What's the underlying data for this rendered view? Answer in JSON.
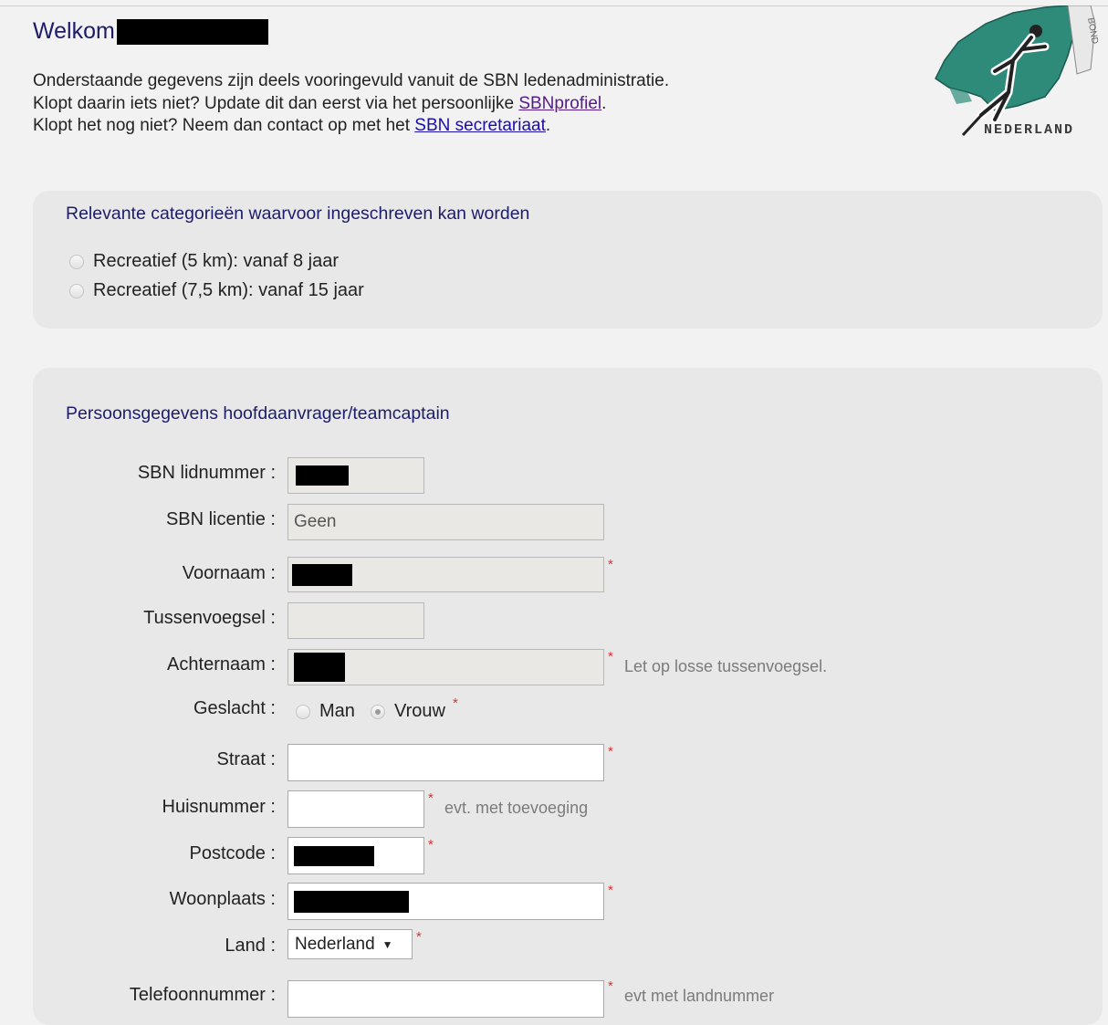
{
  "header": {
    "welcome": "Welkom",
    "intro_line1": "Onderstaande gegevens zijn deels vooringevuld vanuit de SBN ledenadministratie.",
    "intro_line2_pre": "Klopt daarin iets niet? Update dit dan eerst via het persoonlijke ",
    "intro_line2_link": "SBNprofiel",
    "intro_line2_post": ".",
    "intro_line3_pre": "Klopt het nog niet? Neem dan contact op met het ",
    "intro_line3_link": "SBN secretariaat",
    "intro_line3_post": "."
  },
  "logo": {
    "text": "NEDERLAND",
    "side_text": "BOND",
    "icon": "skater-map-logo"
  },
  "categories": {
    "title": "Relevante categorieën waarvoor ingeschreven kan worden",
    "options": [
      {
        "label": "Recreatief (5 km): vanaf 8 jaar",
        "checked": false
      },
      {
        "label": "Recreatief (7,5 km): vanaf 15 jaar",
        "checked": false
      }
    ]
  },
  "person": {
    "title": "Persoonsgegevens hoofdaanvrager/teamcaptain",
    "lidnummer_label": "SBN lidnummer :",
    "licentie_label": "SBN licentie :",
    "licentie_value": "Geen",
    "voornaam_label": "Voornaam :",
    "tussenvoegsel_label": "Tussenvoegsel :",
    "achternaam_label": "Achternaam :",
    "achternaam_hint": "Let op losse tussenvoegsel.",
    "geslacht_label": "Geslacht :",
    "gender_man": "Man",
    "gender_vrouw": "Vrouw",
    "gender_selected": "Vrouw",
    "straat_label": "Straat :",
    "huisnummer_label": "Huisnummer :",
    "huisnummer_hint": "evt. met toevoeging",
    "postcode_label": "Postcode :",
    "woonplaats_label": "Woonplaats :",
    "land_label": "Land :",
    "land_value": "Nederland",
    "telefoon_label": "Telefoonnummer :",
    "telefoon_hint": "evt met landnummer",
    "required_mark": "*"
  },
  "colors": {
    "title": "#1c1c6b",
    "required": "#e03030",
    "logo_green": "#2e8b7a"
  }
}
